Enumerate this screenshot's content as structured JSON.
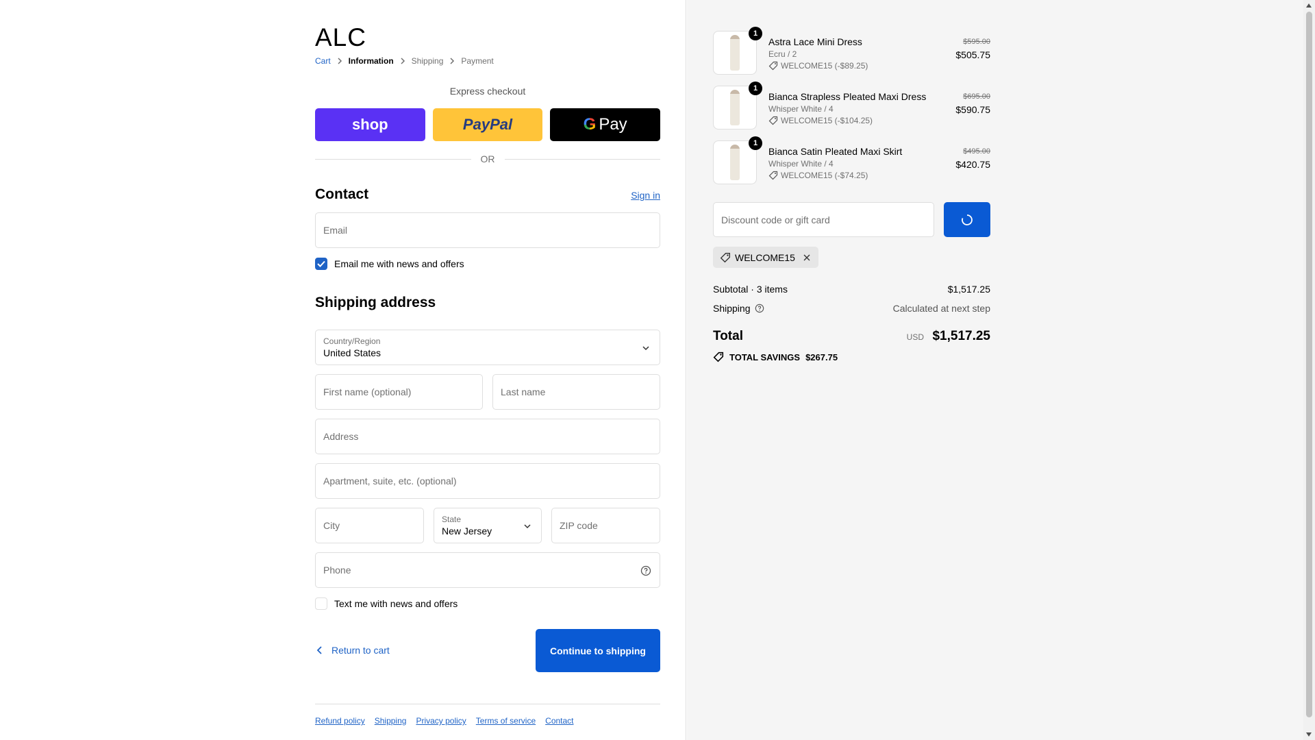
{
  "brand": {
    "logo": "ALC"
  },
  "breadcrumb": {
    "cart": "Cart",
    "information": "Information",
    "shipping": "Shipping",
    "payment": "Payment"
  },
  "express": {
    "title": "Express checkout",
    "shop_label": "shop",
    "paypal_label": "PayPal",
    "gpay_label": "Pay",
    "or": "OR"
  },
  "contact": {
    "title": "Contact",
    "sign_in": "Sign in",
    "email_placeholder": "Email",
    "news_label": "Email me with news and offers",
    "news_checked": true
  },
  "shipping_address": {
    "title": "Shipping address",
    "country_label": "Country/Region",
    "country_value": "United States",
    "first_name_placeholder": "First name (optional)",
    "last_name_placeholder": "Last name",
    "address_placeholder": "Address",
    "apartment_placeholder": "Apartment, suite, etc. (optional)",
    "city_placeholder": "City",
    "state_label": "State",
    "state_value": "New Jersey",
    "zip_placeholder": "ZIP code",
    "phone_placeholder": "Phone",
    "sms_label": "Text me with news and offers",
    "sms_checked": false
  },
  "actions": {
    "return": "Return to cart",
    "continue": "Continue to shipping"
  },
  "footer": {
    "refund": "Refund policy",
    "shipping": "Shipping",
    "privacy": "Privacy policy",
    "terms": "Terms of service",
    "contact": "Contact"
  },
  "order": {
    "items": [
      {
        "qty": "1",
        "name": "Astra Lace Mini Dress",
        "variant": "Ecru / 2",
        "discount": "WELCOME15 (-$89.25)",
        "original": "$595.00",
        "price": "$505.75"
      },
      {
        "qty": "1",
        "name": "Bianca Strapless Pleated Maxi Dress",
        "variant": "Whisper White / 4",
        "discount": "WELCOME15 (-$104.25)",
        "original": "$695.00",
        "price": "$590.75"
      },
      {
        "qty": "1",
        "name": "Bianca Satin Pleated Maxi Skirt",
        "variant": "Whisper White / 4",
        "discount": "WELCOME15 (-$74.25)",
        "original": "$495.00",
        "price": "$420.75"
      }
    ],
    "discount_placeholder": "Discount code or gift card",
    "applied_code": "WELCOME15",
    "subtotal_label": "Subtotal · 3 items",
    "subtotal_value": "$1,517.25",
    "shipping_label": "Shipping",
    "shipping_value": "Calculated at next step",
    "total_label": "Total",
    "currency": "USD",
    "total_value": "$1,517.25",
    "savings_label": "TOTAL SAVINGS",
    "savings_value": "$267.75"
  },
  "colors": {
    "accent": "#0a5ad4",
    "link": "#1f63c6",
    "shop": "#5a31f4",
    "paypal": "#ffc439"
  }
}
